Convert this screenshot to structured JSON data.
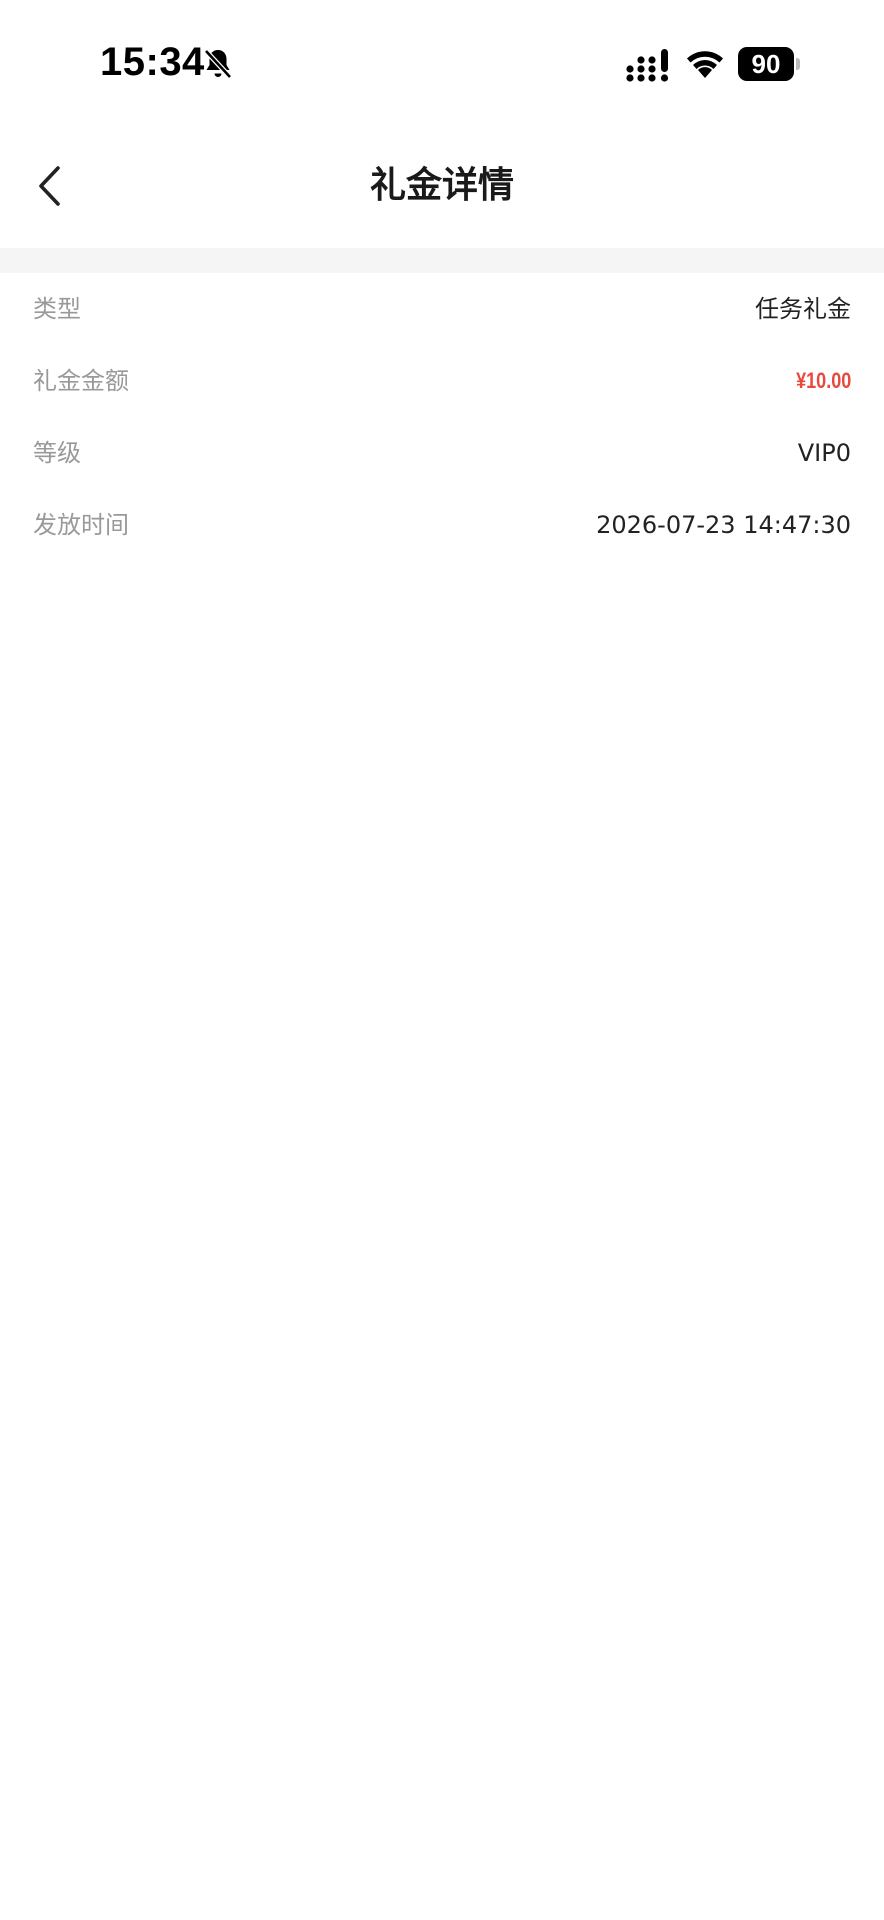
{
  "status_bar": {
    "time": "15:34",
    "battery": "90",
    "icons": [
      "bell-muted-icon",
      "cellular-signal-icon",
      "wifi-icon",
      "battery-icon"
    ]
  },
  "nav": {
    "title": "礼金详情",
    "back_icon": "chevron-left-icon"
  },
  "details": [
    {
      "label": "类型",
      "value": "任务礼金"
    },
    {
      "label": "礼金金额",
      "value": "¥10.00"
    },
    {
      "label": "等级",
      "value": "VIP0"
    },
    {
      "label": "发放时间",
      "value": "2026-07-23 14:47:30"
    }
  ],
  "colors": {
    "amount": "#e8493f",
    "label": "#999999",
    "value": "#222222",
    "divider": "#f5f5f5"
  }
}
